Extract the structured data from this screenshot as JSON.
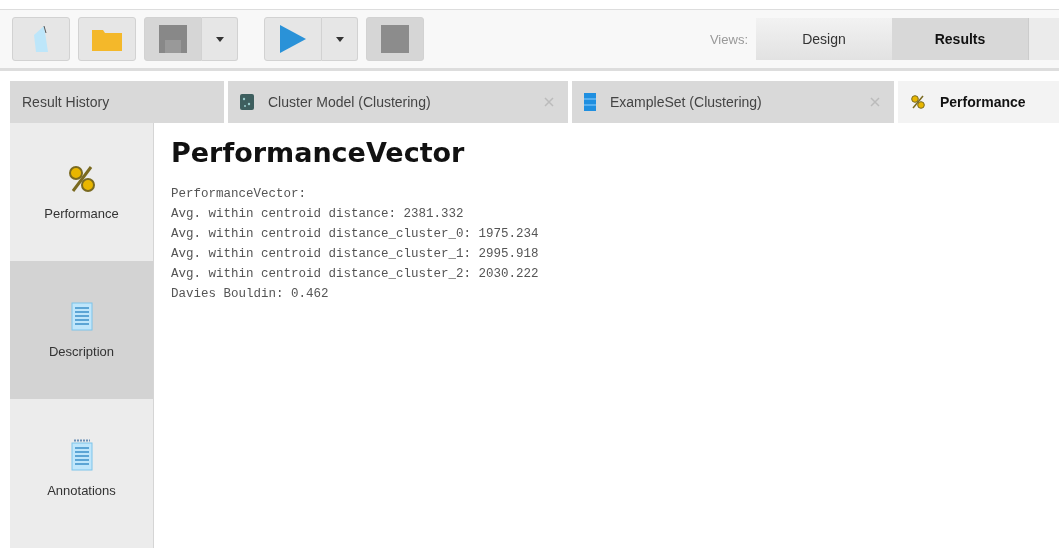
{
  "toolbar": {
    "views_label": "Views:",
    "views": [
      {
        "label": "Design",
        "selected": false
      },
      {
        "label": "Results",
        "selected": true
      }
    ]
  },
  "tabs": [
    {
      "label": "Result History",
      "kind": "history",
      "selected": false,
      "closable": false
    },
    {
      "label": "Cluster Model (Clustering)",
      "kind": "model",
      "selected": false,
      "closable": true
    },
    {
      "label": "ExampleSet (Clustering)",
      "kind": "exampleset",
      "selected": false,
      "closable": true
    },
    {
      "label": "Performance",
      "kind": "performance",
      "selected": true,
      "closable": false
    }
  ],
  "sidebar": {
    "items": [
      {
        "label": "Performance",
        "kind": "percent",
        "selected": false
      },
      {
        "label": "Description",
        "kind": "document",
        "selected": true
      },
      {
        "label": "Annotations",
        "kind": "notepad",
        "selected": false
      }
    ]
  },
  "content": {
    "title": "PerformanceVector",
    "lines": [
      "PerformanceVector:",
      "Avg. within centroid distance: 2381.332",
      "Avg. within centroid distance_cluster_0: 1975.234",
      "Avg. within centroid distance_cluster_1: 2995.918",
      "Avg. within centroid distance_cluster_2: 2030.222",
      "Davies Bouldin: 0.462"
    ]
  }
}
